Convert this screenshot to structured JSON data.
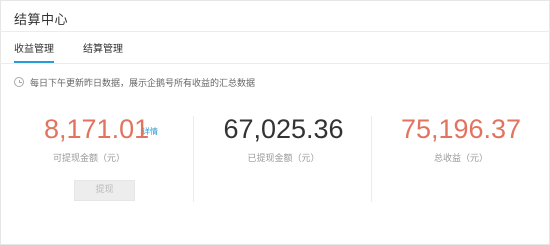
{
  "header": {
    "title": "结算中心"
  },
  "tabs": [
    {
      "label": "收益管理",
      "active": true
    },
    {
      "label": "结算管理",
      "active": false
    }
  ],
  "notice": {
    "icon": "clock-icon",
    "text": "每日下午更新昨日数据，展示企鹅号所有收益的汇总数据"
  },
  "stats": {
    "withdrawable": {
      "value": "8,171.01",
      "label": "可提现金额（元）",
      "link": "详情"
    },
    "withdrawn": {
      "value": "67,025.36",
      "label": "已提现金额（元）"
    },
    "total": {
      "value": "75,196.37",
      "label": "总收益（元）"
    }
  },
  "withdraw_button": {
    "label": "提现",
    "enabled": false
  },
  "colors": {
    "accent": "#2b9bd8",
    "highlight": "#e2735f",
    "text": "#333333",
    "muted": "#999999"
  }
}
